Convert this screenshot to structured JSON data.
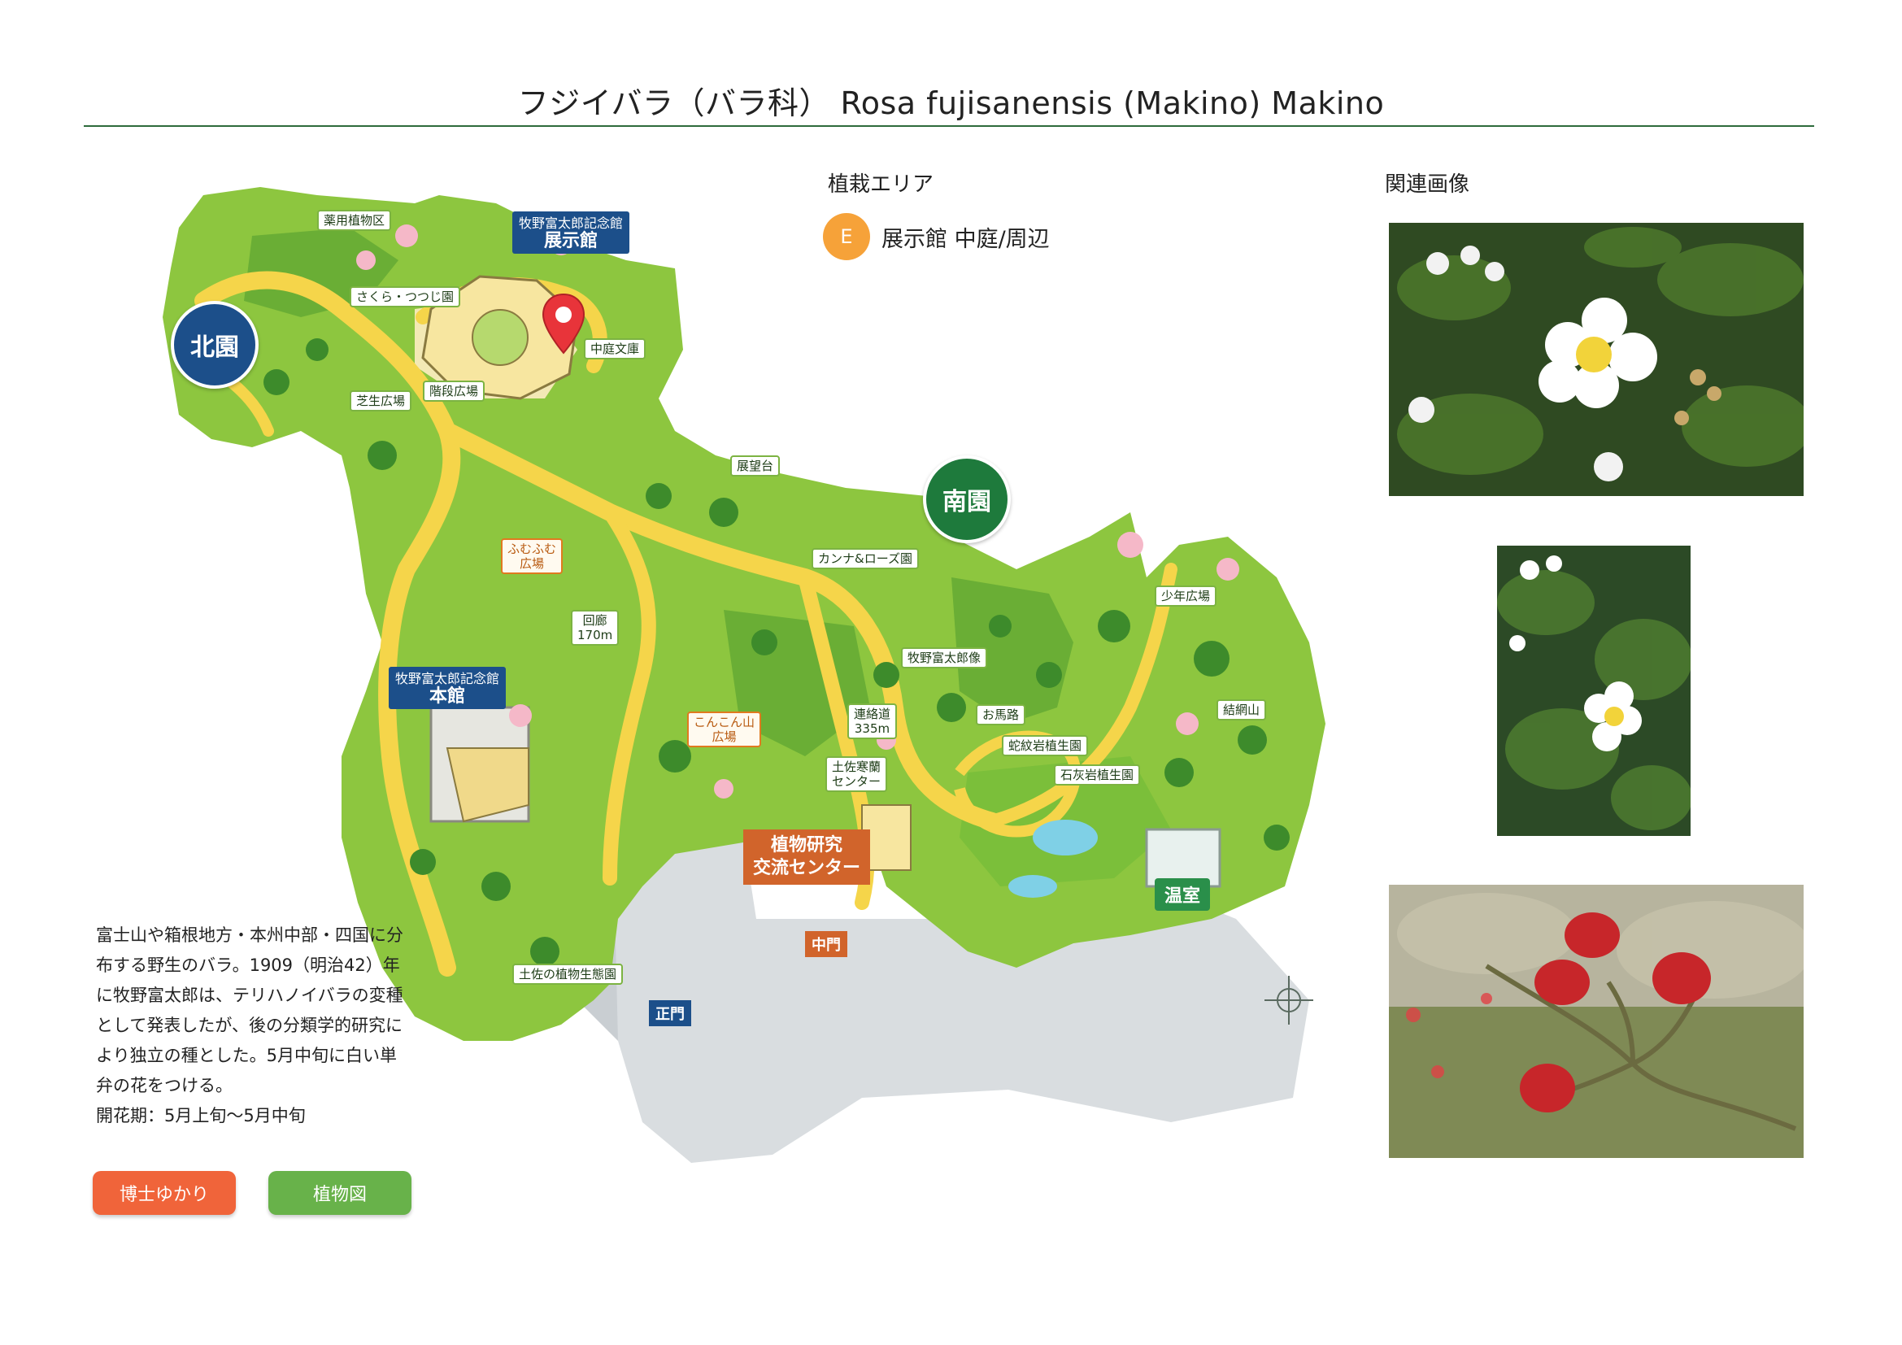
{
  "title": "フジイバラ（バラ科） Rosa fujisanensis (Makino) Makino",
  "planting_area": {
    "heading": "植栽エリア",
    "badge": "E",
    "location": "展示館 中庭/周辺",
    "badge_color": "#f6a239"
  },
  "related_images": {
    "heading": "関連画像",
    "images": [
      {
        "icon": "white-rose-blossom-photo"
      },
      {
        "icon": "white-rose-branch-photo"
      },
      {
        "icon": "red-rose-hips-photo"
      }
    ]
  },
  "map": {
    "zones": {
      "north": "北園",
      "south": "南園"
    },
    "labels": {
      "yakuyo": "薬用植物区",
      "sakura": "さくら・つつじ園",
      "shiba": "芝生広場",
      "kaidan": "階段広場",
      "nakaniwa": "中庭文庫",
      "tenbodai": "展望台",
      "cannarose": "カンナ&ローズ園",
      "kairou": "回廊\n170m",
      "konkon": "こんこん山\n広場",
      "fumufumu": "ふむふむ\n広場",
      "renraku": "連絡道\n335m",
      "tosakan": "土佐寒蘭\nセンター",
      "makinozo": "牧野富太郎像",
      "omichi": "お馬路",
      "jamongan": "蛇紋岩植生園",
      "sekkaigan": "石灰岩植生園",
      "shonen": "少年広場",
      "kekkou": "結網山",
      "tosa": "土佐の植物生態園"
    },
    "museum_exhibit": {
      "line1": "牧野富太郎記念館",
      "line2": "展示館"
    },
    "museum_main": {
      "line1": "牧野富太郎記念館",
      "line2": "本館"
    },
    "research": {
      "line1": "植物研究",
      "line2": "交流センター"
    },
    "greenhouse": "温室",
    "gates": {
      "main": "正門",
      "middle": "中門"
    },
    "pin_color": "#e8343a"
  },
  "description": {
    "text": "富士山や箱根地方・本州中部・四国に分布する野生のバラ。1909（明治42）年に牧野富太郎は、テリハノイバラの変種として発表したが、後の分類学的研究により独立の種とした。5月中旬に白い単弁の花をつける。",
    "bloom": "開花期：5月上旬〜5月中旬"
  },
  "buttons": {
    "hakase": "博士ゆかり",
    "shokubutsuzu": "植物図"
  }
}
